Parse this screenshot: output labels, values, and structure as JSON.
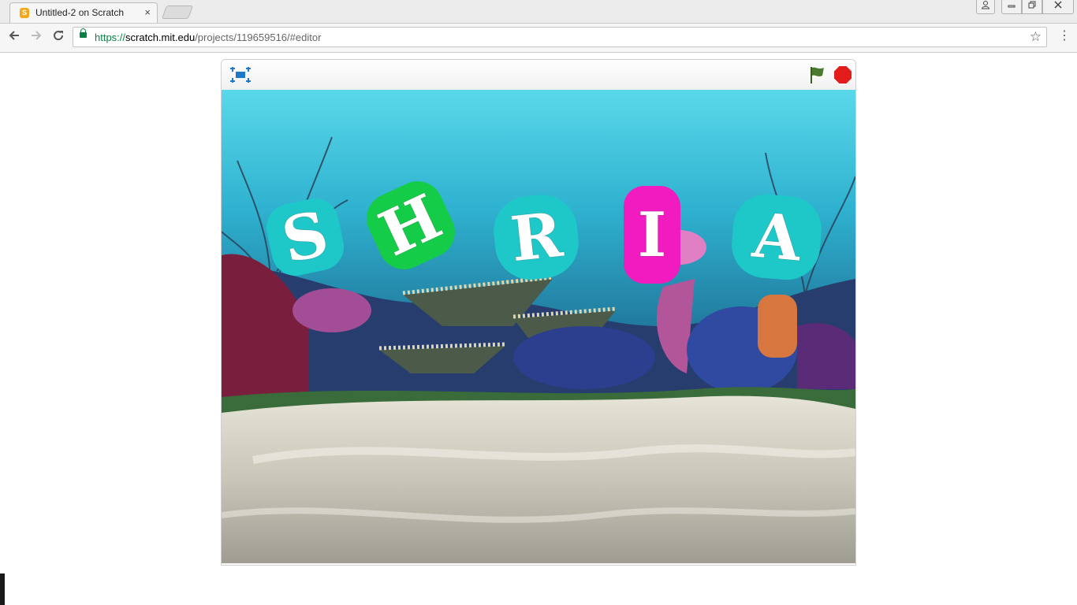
{
  "browser": {
    "tab_title": "Untitled-2 on Scratch",
    "tab_close": "×",
    "url_protocol": "https://",
    "url_host": "scratch.mit.edu",
    "url_path": "/projects/119659516/#editor",
    "icons": [
      "scratch-favicon",
      "back-arrow-icon",
      "forward-arrow-icon",
      "reload-icon",
      "lock-icon",
      "star-icon",
      "menu-icon",
      "user-icon",
      "minimize-icon",
      "maximize-icon",
      "close-icon"
    ]
  },
  "player": {
    "icons": [
      "fullscreen-icon",
      "green-flag-icon",
      "stop-icon"
    ],
    "colors": {
      "flag": "#4a7a2e",
      "stop": "#e21b1b",
      "fullscreen": "#1f78c8"
    }
  },
  "stage": {
    "sprites": [
      {
        "letter": "S",
        "color": "#1ec8c8"
      },
      {
        "letter": "H",
        "color": "#14cc47"
      },
      {
        "letter": "R",
        "color": "#1ec8c8"
      },
      {
        "letter": "I",
        "color": "#f21bbf"
      },
      {
        "letter": "A",
        "color": "#1ec8c8"
      }
    ],
    "backdrop": "underwater reef"
  }
}
